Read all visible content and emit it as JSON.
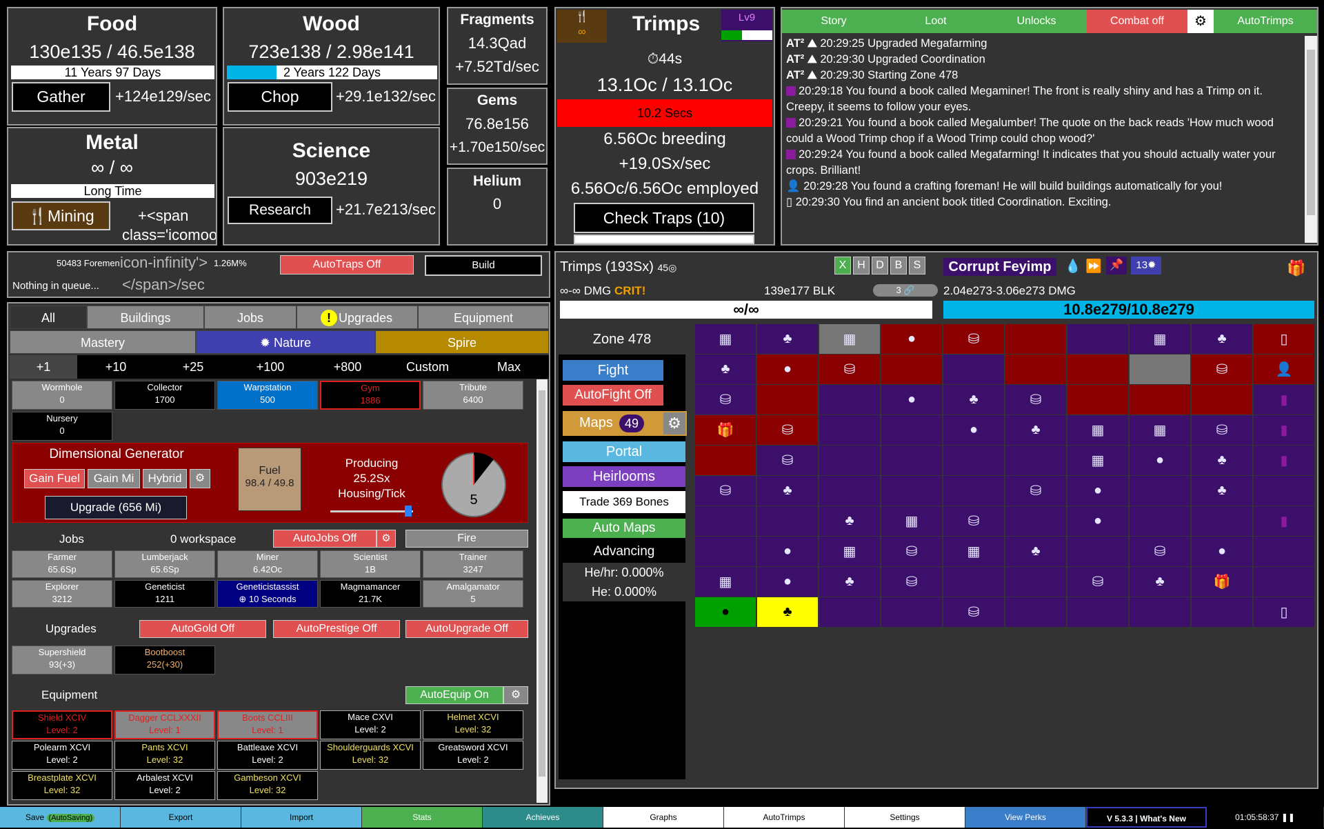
{
  "resources": {
    "food": {
      "title": "Food",
      "amount": "130e135 / 46.5e138",
      "bar_text": "11 Years 97 Days",
      "button": "Gather",
      "rate": "+124e129/sec"
    },
    "wood": {
      "title": "Wood",
      "amount": "723e138 / 2.98e141",
      "bar_text": "2 Years 122 Days",
      "button": "Chop",
      "rate": "+29.1e132/sec"
    },
    "metal": {
      "title": "Metal",
      "amount": "∞ / ∞",
      "bar_text": "Long Time",
      "button": "Mining",
      "rate_line1": "+<span",
      "rate_line2": "class='icomoon"
    },
    "science": {
      "title": "Science",
      "amount": "903e219",
      "button": "Research",
      "rate": "+21.7e213/sec"
    },
    "fragments": {
      "title": "Fragments",
      "amount": "14.3Qad",
      "rate": "+7.52Td/sec"
    },
    "gems": {
      "title": "Gems",
      "amount": "76.8e156",
      "rate": "+1.70e150/sec"
    },
    "helium": {
      "title": "Helium",
      "amount": "0"
    }
  },
  "trimps": {
    "title": "Trimps",
    "level": "Lv9",
    "timer": "44s",
    "amount": "13.1Oc / 13.1Oc",
    "red_bar": "10.2 Secs",
    "breeding": "6.56Oc breeding",
    "rate": "+19.0Sx/sec",
    "employed": "6.56Oc/6.56Oc employed",
    "check_traps": "Check Traps (10)"
  },
  "log": {
    "tabs": [
      "Story",
      "Loot",
      "Unlocks",
      "Combat off",
      "AutoTrimps"
    ],
    "messages": [
      {
        "icon": "at",
        "text": "20:29:25 Upgraded Megafarming"
      },
      {
        "icon": "at",
        "text": "20:29:30 Upgraded Coordination"
      },
      {
        "icon": "at",
        "text": "20:29:30 Starting Zone 478"
      },
      {
        "icon": "book",
        "text": "20:29:18 You found a book called Megaminer! The front is really shiny and has a Trimp on it. Creepy, it seems to follow your eyes."
      },
      {
        "icon": "book",
        "text": "20:29:21 You found a book called Megalumber! The quote on the back reads 'How much wood could a Wood Trimp chop if a Wood Trimp could chop wood?'"
      },
      {
        "icon": "book",
        "text": "20:29:24 You found a book called Megafarming! It indicates that you should actually water your crops. Brilliant!"
      },
      {
        "icon": "person",
        "text": "20:29:28 You found a crafting foreman! He will build buildings automatically for you!"
      },
      {
        "icon": "doc",
        "text": "20:29:30 You find an ancient book titled Coordination. Exciting."
      }
    ]
  },
  "queue": {
    "foremen": "50483 Foremen",
    "infinity_tag": "icon-infinity'>",
    "percent": "1.26M%",
    "nothing": "Nothing in queue...",
    "span_close": "</span>/sec",
    "autotraps": "AutoTraps Off",
    "build": "Build"
  },
  "tabs": {
    "row1": [
      "All",
      "Buildings",
      "Jobs",
      "Upgrades",
      "Equipment"
    ],
    "row2": [
      "Mastery",
      "Nature",
      "Spire"
    ],
    "amounts": [
      "+1",
      "+10",
      "+25",
      "+100",
      "+800",
      "Custom",
      "Max"
    ]
  },
  "buildings": [
    {
      "name": "Wormhole",
      "value": "0"
    },
    {
      "name": "Collector",
      "value": "1700"
    },
    {
      "name": "Warpstation",
      "value": "500"
    },
    {
      "name": "Gym",
      "value": "1886"
    },
    {
      "name": "Tribute",
      "value": "6400"
    },
    {
      "name": "Nursery",
      "value": "0"
    }
  ],
  "dg": {
    "title": "Dimensional Generator",
    "buttons": [
      "Gain Fuel",
      "Gain Mi",
      "Hybrid"
    ],
    "upgrade": "Upgrade (656 Mi)",
    "fuel_label": "Fuel",
    "fuel_value": "98.4 / 49.8",
    "producing_label": "Producing",
    "producing_value": "25.2Sx",
    "producing_unit": "Housing/Tick",
    "dial": "5"
  },
  "jobs": {
    "label": "Jobs",
    "workspace": "0 workspace",
    "autojobs": "AutoJobs Off",
    "fire": "Fire",
    "list": [
      {
        "name": "Farmer",
        "value": "65.6Sp"
      },
      {
        "name": "Lumberjack",
        "value": "65.6Sp"
      },
      {
        "name": "Miner",
        "value": "6.42Oc"
      },
      {
        "name": "Scientist",
        "value": "1B"
      },
      {
        "name": "Trainer",
        "value": "3247"
      },
      {
        "name": "Explorer",
        "value": "3212"
      },
      {
        "name": "Geneticist",
        "value": "1211"
      },
      {
        "name": "Geneticistassist",
        "value": "10 Seconds"
      },
      {
        "name": "Magmamancer",
        "value": "21.7K"
      },
      {
        "name": "Amalgamator",
        "value": "5"
      }
    ]
  },
  "upgrades": {
    "label": "Upgrades",
    "autogold": "AutoGold Off",
    "autoprestige": "AutoPrestige Off",
    "autoupgrade": "AutoUpgrade Off",
    "list": [
      {
        "name": "Supershield",
        "value": "93(+3)"
      },
      {
        "name": "Bootboost",
        "value": "252(+30)"
      }
    ]
  },
  "equipment": {
    "label": "Equipment",
    "autoequip": "AutoEquip On",
    "list": [
      {
        "name": "Shield XCIV",
        "level": "Level: 2"
      },
      {
        "name": "Dagger CCLXXXII",
        "level": "Level: 1"
      },
      {
        "name": "Boots CCLIII",
        "level": "Level: 1"
      },
      {
        "name": "Mace CXVI",
        "level": "Level: 2"
      },
      {
        "name": "Helmet XCVI",
        "level": "Level: 32"
      },
      {
        "name": "Polearm XCVI",
        "level": "Level: 2"
      },
      {
        "name": "Pants XCVI",
        "level": "Level: 32"
      },
      {
        "name": "Battleaxe XCVI",
        "level": "Level: 2"
      },
      {
        "name": "Shoulderguards XCVI",
        "level": "Level: 32"
      },
      {
        "name": "Greatsword XCVI",
        "level": "Level: 2"
      },
      {
        "name": "Breastplate XCVI",
        "level": "Level: 32"
      },
      {
        "name": "Arbalest XCVI",
        "level": "Level: 2"
      },
      {
        "name": "Gambeson XCVI",
        "level": "Level: 32"
      }
    ]
  },
  "battle": {
    "trimps_label": "Trimps (193Sx)",
    "trimps_count": "45",
    "letters": [
      "X",
      "H",
      "D",
      "B",
      "S"
    ],
    "enemy_name": "Corrupt Feyimp",
    "enemy_badge": "13",
    "dmg": "∞-∞ DMG",
    "crit": "CRIT!",
    "blk": "139e177 BLK",
    "trimp_hp": "∞/∞",
    "enemy_dmg": "2.04e273-3.06e273 DMG",
    "enemy_hp": "10.8e279/10.8e279",
    "chain": "3"
  },
  "zone": {
    "label": "Zone 478",
    "fight": "Fight",
    "autofight": "AutoFight Off",
    "maps": "Maps",
    "maps_count": "49",
    "portal": "Portal",
    "heirlooms": "Heirlooms",
    "trade": "Trade 369 Bones",
    "automaps": "Auto Maps",
    "advancing": "Advancing",
    "hehr": "He/hr: 0.000%",
    "he": "He: 0.000%"
  },
  "bottom": {
    "buttons": [
      "Save",
      "Export",
      "Import",
      "Stats",
      "Achieves",
      "Graphs",
      "AutoTrimps",
      "Settings",
      "View Perks"
    ],
    "autosaving": "(AutoSaving)",
    "version": "V 5.3.3 | What's New",
    "time": "01:05:58:37"
  },
  "colors": {
    "purple": "#3b0f6a",
    "red": "#8b0000",
    "bluebar": "#00b4e8"
  }
}
